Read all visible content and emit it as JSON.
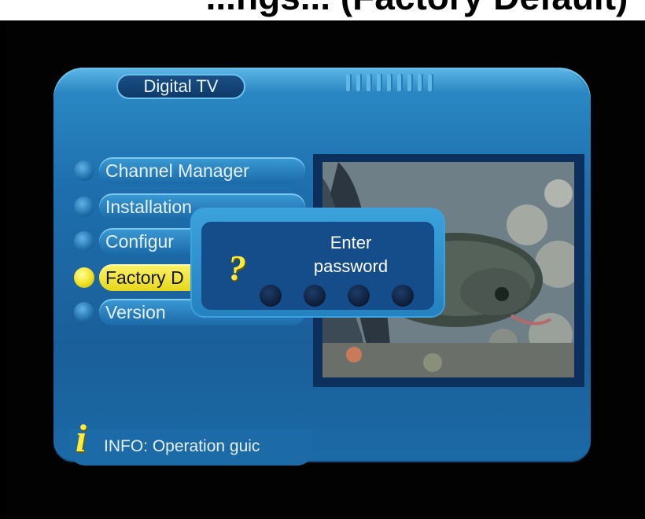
{
  "caption": {
    "text": "...ngs... (Factory Default)"
  },
  "app": {
    "title": "Digital TV"
  },
  "menu": {
    "items": [
      {
        "label": "Channel Manager",
        "state": "normal"
      },
      {
        "label": "Installation",
        "state": "normal"
      },
      {
        "label": "Configur",
        "state": "normal"
      },
      {
        "label": "Factory D",
        "state": "selected"
      },
      {
        "label": "Version",
        "state": "normal"
      }
    ],
    "selected_index": 3
  },
  "dialog": {
    "title_line1": "Enter",
    "title_line2": "password",
    "icon": "question-mark-icon",
    "password_length": 4,
    "entered": 0
  },
  "info": {
    "icon": "info-i-icon",
    "text": "INFO: Operation guic"
  },
  "colors": {
    "panel_blue": "#1e6fae",
    "highlight_yellow": "#f0e020",
    "dialog_blue": "#154d8a",
    "icon_yellow": "#ffeb3b"
  }
}
